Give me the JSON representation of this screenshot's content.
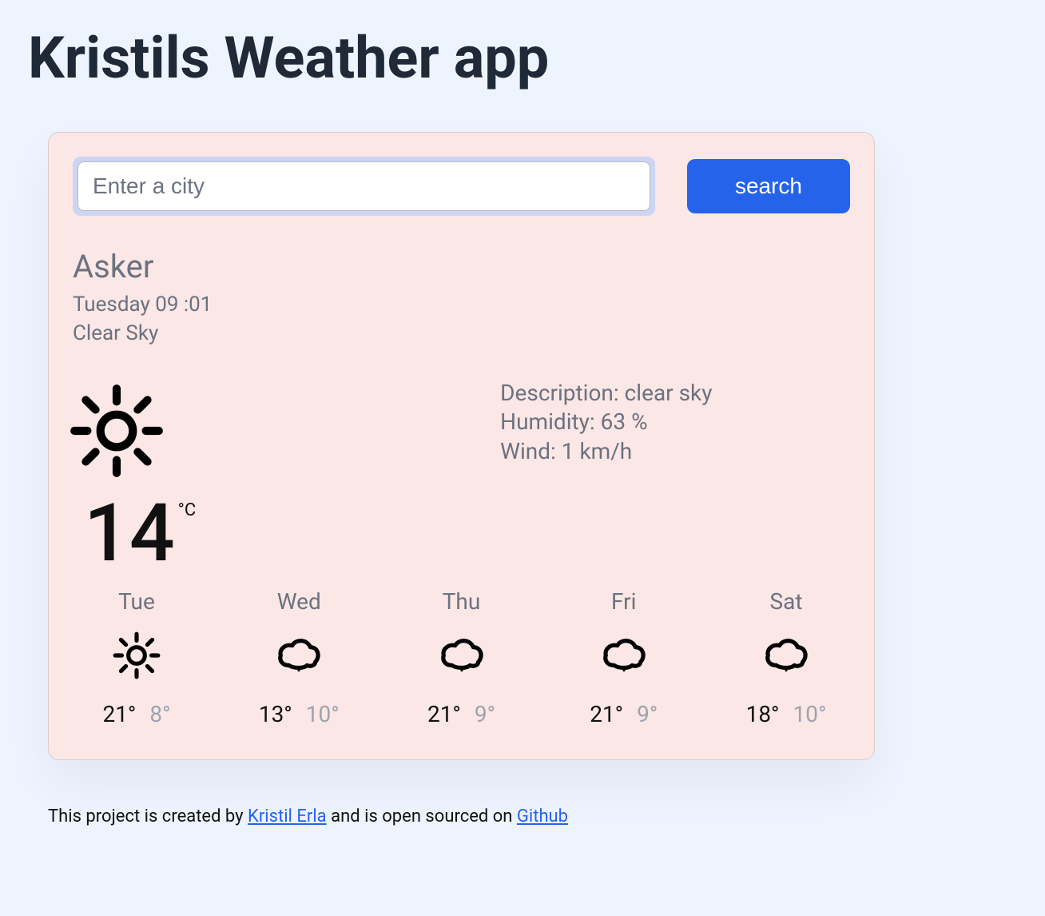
{
  "app": {
    "title": "Kristils Weather app"
  },
  "search": {
    "placeholder": "Enter a city",
    "button_label": "search"
  },
  "current": {
    "city": "Asker",
    "datetime": "Tuesday 09 :01",
    "condition": "Clear Sky",
    "temperature": "14",
    "unit": "°C",
    "icon": "sun"
  },
  "details": {
    "description_label": "Description:",
    "description_value": "clear sky",
    "humidity_label": "Humidity:",
    "humidity_value": "63 %",
    "wind_label": "Wind:",
    "wind_value": "1 km/h"
  },
  "forecast": [
    {
      "day": "Tue",
      "icon": "sun",
      "high": "21°",
      "low": "8°"
    },
    {
      "day": "Wed",
      "icon": "cloud",
      "high": "13°",
      "low": "10°"
    },
    {
      "day": "Thu",
      "icon": "cloud",
      "high": "21°",
      "low": "9°"
    },
    {
      "day": "Fri",
      "icon": "cloud",
      "high": "21°",
      "low": "9°"
    },
    {
      "day": "Sat",
      "icon": "cloud",
      "high": "18°",
      "low": "10°"
    }
  ],
  "footer": {
    "pre": "This project is created by ",
    "author": "Kristil Erla",
    "mid": " and is open sourced on ",
    "repo": "Github"
  }
}
